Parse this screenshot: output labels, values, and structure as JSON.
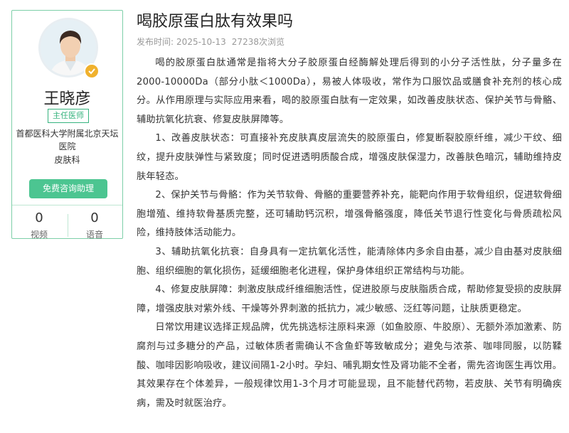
{
  "doctor": {
    "name": "王晓彦",
    "title": "主任医师",
    "hospital": "首都医科大学附属北京天坛医院",
    "department": "皮肤科",
    "consult_label": "免费咨询助理",
    "stats": [
      {
        "value": "0",
        "label": "视频"
      },
      {
        "value": "0",
        "label": "语音"
      }
    ]
  },
  "article": {
    "title": "喝胶原蛋白肽有效果吗",
    "publish_prefix": "发布时间:",
    "publish_date": "2025-10-13",
    "views": "27238次浏览",
    "paragraphs": [
      "喝的胶原蛋白肽通常是指将大分子胶原蛋白经酶解处理后得到的小分子活性肽，分子量多在2000-10000Da（部分小肽＜1000Da），易被人体吸收，常作为口服饮品或膳食补充剂的核心成分。从作用原理与实际应用来看，喝的胶原蛋白肽有一定效果，如改善皮肤状态、保护关节与骨骼、辅助抗氧化抗衰、修复皮肤屏障等。",
      "1、改善皮肤状态：可直接补充皮肤真皮层流失的胶原蛋白，修复断裂胶原纤维，减少干纹、细纹，提升皮肤弹性与紧致度；同时促进透明质酸合成，增强皮肤保湿力，改善肤色暗沉，辅助维持皮肤年轻态。",
      "2、保护关节与骨骼：作为关节软骨、骨骼的重要营养补充，能靶向作用于软骨组织，促进软骨细胞增殖、维持软骨基质完整，还可辅助钙沉积，增强骨骼强度，降低关节退行性变化与骨质疏松风险，维持肢体活动能力。",
      "3、辅助抗氧化抗衰：自身具有一定抗氧化活性，能清除体内多余自由基，减少自由基对皮肤细胞、组织细胞的氧化损伤，延缓细胞老化进程，保护身体组织正常结构与功能。",
      "4、修复皮肤屏障：刺激皮肤成纤维细胞活性，促进胶原与皮肤脂质合成，帮助修复受损的皮肤屏障，增强皮肤对紫外线、干燥等外界刺激的抵抗力，减少敏感、泛红等问题，让肤质更稳定。",
      "日常饮用建议选择正规品牌，优先挑选标注原料来源（如鱼胶原、牛胶原）、无额外添加激素、防腐剂与过多糖分的产品，过敏体质者需确认不含鱼虾等致敏成分；避免与浓茶、咖啡同服，以防鞣酸、咖啡因影响吸收，建议间隔1-2小时。孕妇、哺乳期女性及肾功能不全者，需先咨询医生再饮用。其效果存在个体差异，一般规律饮用1-3个月才可能显现，且不能替代药物，若皮肤、关节有明确疾病，需及时就医治疗。"
    ]
  },
  "colors": {
    "accent": "#4cc591",
    "border": "#7dcfa8",
    "badge": "#f0b12d"
  }
}
